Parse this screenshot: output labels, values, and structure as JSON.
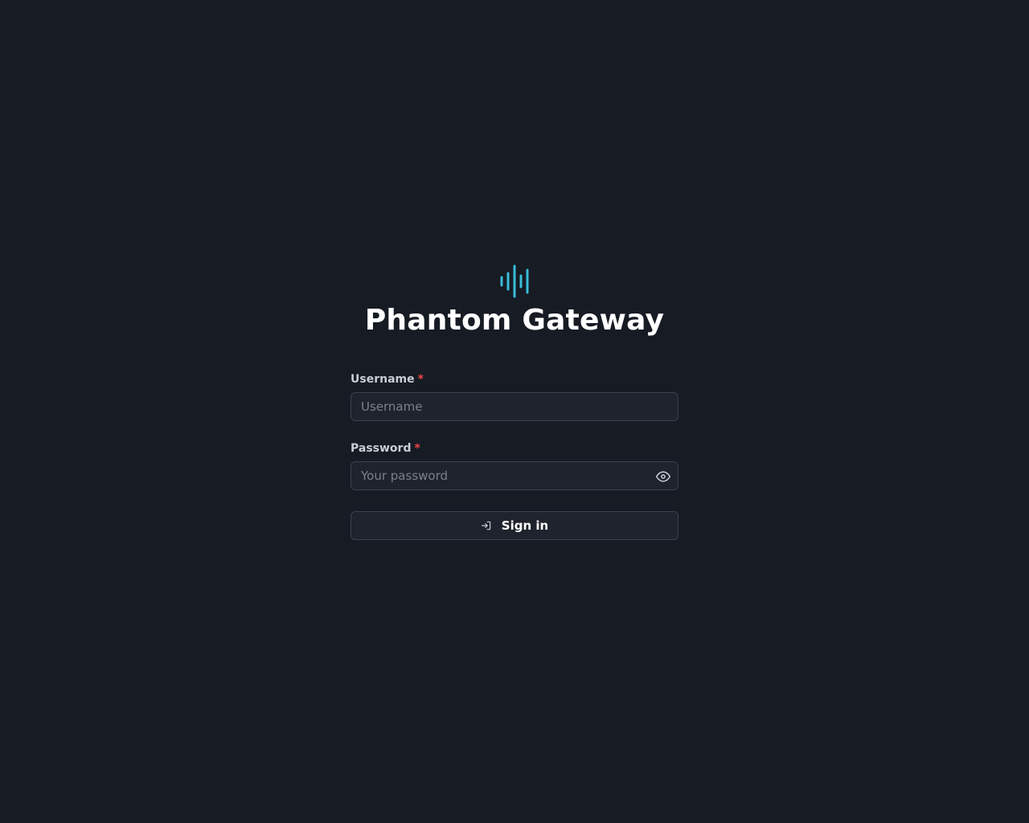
{
  "app": {
    "title": "Phantom Gateway",
    "logo_icon": "soundwave-icon",
    "accent_color": "#38bdd8"
  },
  "form": {
    "username": {
      "label": "Username",
      "required_mark": "*",
      "placeholder": "Username",
      "value": ""
    },
    "password": {
      "label": "Password",
      "required_mark": "*",
      "placeholder": "Your password",
      "value": "",
      "toggle_icon": "eye-icon"
    },
    "submit": {
      "label": "Sign in",
      "icon": "login-icon"
    }
  }
}
